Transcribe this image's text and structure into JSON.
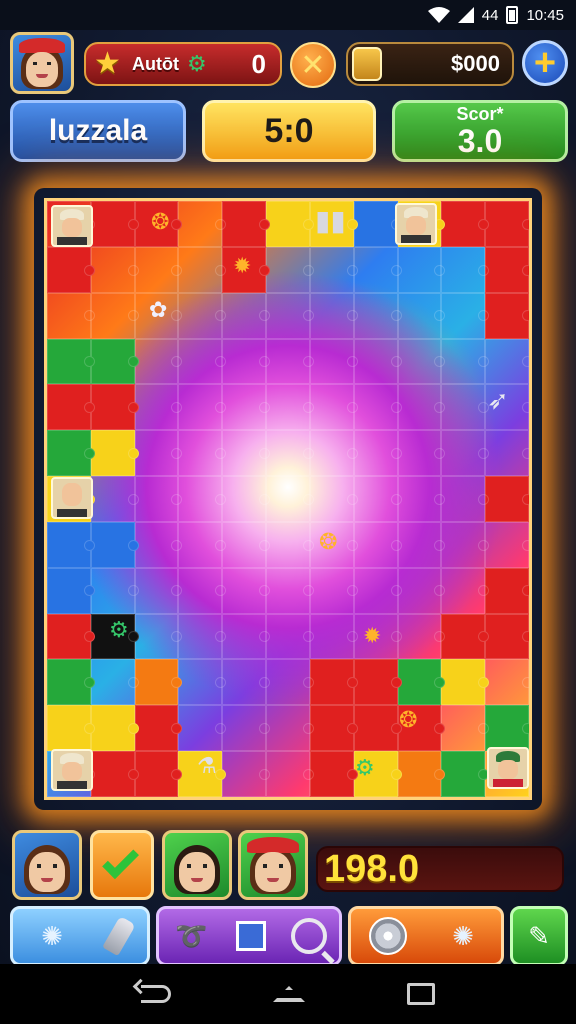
{
  "status_bar": {
    "time": "10:45",
    "signal_text": "44"
  },
  "hud": {
    "auto_label": "Autōt",
    "auto_value": "0",
    "close_symbol": "✕",
    "money": "$000",
    "plus_symbol": "+",
    "title": "luzzala",
    "timer": "5:0",
    "score_label": "Scor*",
    "score_value": "3.0"
  },
  "board": {
    "columns": 11,
    "rows": 13,
    "colors": {
      "frame_glow": "#ff961e",
      "frame_border": "#ffd27a"
    }
  },
  "bottom": {
    "counter": "198.0"
  },
  "icons": {
    "star": "star-icon",
    "gadget": "gadget-icon",
    "jar": "jar-icon"
  }
}
